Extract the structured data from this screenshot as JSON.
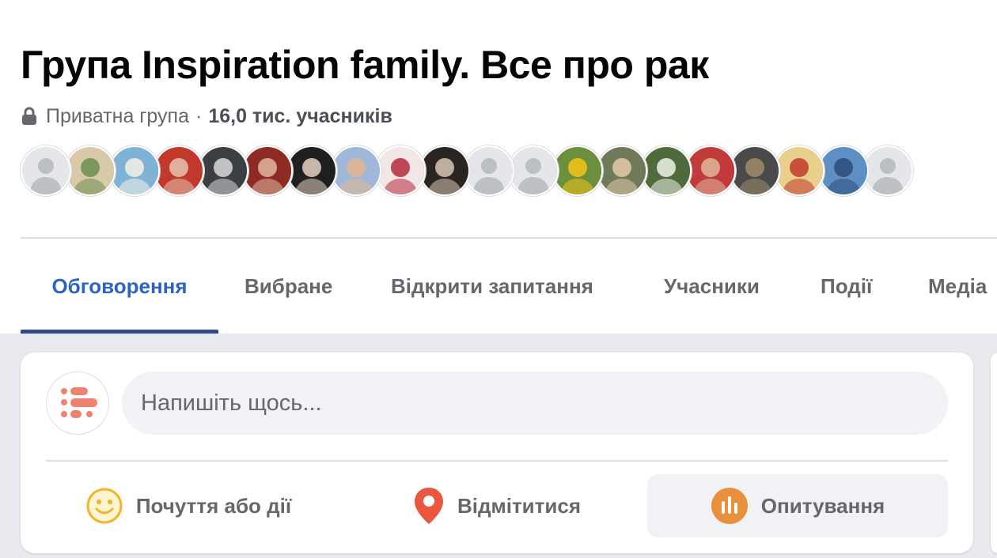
{
  "group": {
    "title": "Група Inspiration family. Все про рак",
    "privacy_label": "Приватна група",
    "separator": "·",
    "members_label": "16,0 тис. учасників"
  },
  "member_avatars": [
    {
      "type": "default",
      "bg": "#e4e6eb",
      "fg": "#bcc0c4"
    },
    {
      "type": "photo",
      "bg": "#d9c9a8",
      "fg": "#6b8e4e"
    },
    {
      "type": "photo",
      "bg": "#7fb3d5",
      "fg": "#f4f1e8"
    },
    {
      "type": "photo",
      "bg": "#c0392b",
      "fg": "#e8c4b0"
    },
    {
      "type": "photo",
      "bg": "#3a3f44",
      "fg": "#d9d9d9"
    },
    {
      "type": "photo",
      "bg": "#8e2b24",
      "fg": "#e2b8a0"
    },
    {
      "type": "photo",
      "bg": "#1f1f1f",
      "fg": "#e6d2c0"
    },
    {
      "type": "photo",
      "bg": "#9fb8d9",
      "fg": "#e3b48f"
    },
    {
      "type": "photo",
      "bg": "#f2e6e6",
      "fg": "#b5283a"
    },
    {
      "type": "photo",
      "bg": "#2b2522",
      "fg": "#d8c7b3"
    },
    {
      "type": "default",
      "bg": "#e4e6eb",
      "fg": "#bcc0c4"
    },
    {
      "type": "default",
      "bg": "#e4e6eb",
      "fg": "#bcc0c4"
    },
    {
      "type": "photo",
      "bg": "#6c8f3d",
      "fg": "#f5c518"
    },
    {
      "type": "photo",
      "bg": "#6f7a5a",
      "fg": "#e6c9a8"
    },
    {
      "type": "photo",
      "bg": "#4f6b3c",
      "fg": "#eef2e6"
    },
    {
      "type": "photo",
      "bg": "#c23b3b",
      "fg": "#e0b89a"
    },
    {
      "type": "photo",
      "bg": "#4a4a4a",
      "fg": "#a08a6a"
    },
    {
      "type": "photo",
      "bg": "#e8cf8c",
      "fg": "#c0392b"
    },
    {
      "type": "photo",
      "bg": "#5d8fc4",
      "fg": "#2b4d7a"
    },
    {
      "type": "default",
      "bg": "#e4e6eb",
      "fg": "#bcc0c4"
    }
  ],
  "tabs": [
    {
      "label": "Обговорення",
      "active": true
    },
    {
      "label": "Вибране",
      "active": false
    },
    {
      "label": "Відкрити запитання",
      "active": false
    },
    {
      "label": "Учасники",
      "active": false
    },
    {
      "label": "Події",
      "active": false
    },
    {
      "label": "Медіа",
      "active": false
    }
  ],
  "composer": {
    "placeholder": "Напишіть щось...",
    "actions": [
      {
        "label": "Почуття або дії",
        "icon": "smiley-icon",
        "color": "#f0b429"
      },
      {
        "label": "Відмітитися",
        "icon": "location-pin-icon",
        "color": "#e9573f"
      },
      {
        "label": "Опитування",
        "icon": "poll-icon",
        "color": "#e8913a"
      }
    ]
  },
  "colors": {
    "accent": "#2d64c4",
    "tab_indicator": "#2f4a8b",
    "muted_text": "#65676b",
    "feed_background": "#e9eaf0",
    "brand_logo": "#f08070"
  }
}
